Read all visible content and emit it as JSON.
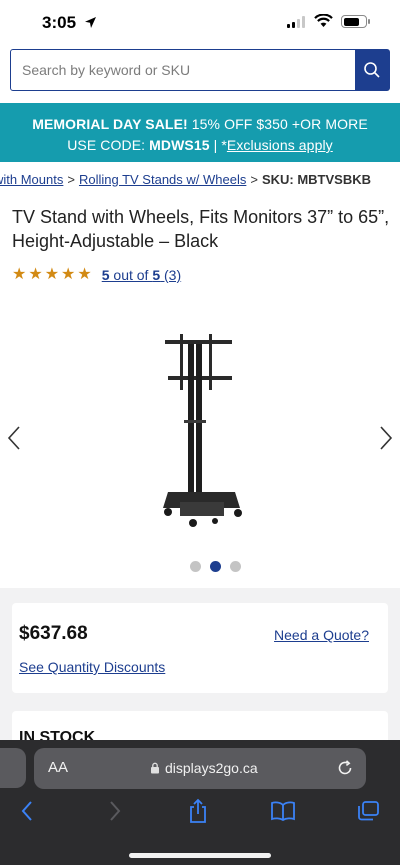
{
  "status": {
    "time": "3:05"
  },
  "search": {
    "placeholder": "Search by keyword or SKU"
  },
  "promo": {
    "line1_bold": "MEMORIAL DAY SALE!",
    "line1_rest": " 15% OFF $350 +OR MORE",
    "line2_prefix": "USE CODE: ",
    "code": "MDWS15",
    "line2_sep": " | *",
    "exclusions": "Exclusions apply",
    "bg_color": "#159cae"
  },
  "breadcrumb": {
    "items": [
      "with Mounts",
      "Rolling TV Stands w/ Wheels"
    ],
    "separator": ">",
    "sku": "SKU: MBTVSBKB"
  },
  "product": {
    "title": "TV Stand with Wheels, Fits Monitors 37” to 65”, Height-Adjustable – Black",
    "rating": {
      "value": 5,
      "max": 5,
      "count": 3,
      "text_value": "5",
      "text_mid": " out of ",
      "text_max": "5",
      "text_count": " (3)"
    },
    "image_index": 2,
    "image_count": 3,
    "price": "$637.68",
    "quote_link": "Need a Quote?",
    "quantity_link": "See Quantity Discounts",
    "stock": "IN STOCK"
  },
  "browser": {
    "aa_label": "AA",
    "url": "displays2go.ca"
  },
  "colors": {
    "brand": "#1d3e8f",
    "star": "#d28a14",
    "browser_bg": "#2c2c2e"
  }
}
